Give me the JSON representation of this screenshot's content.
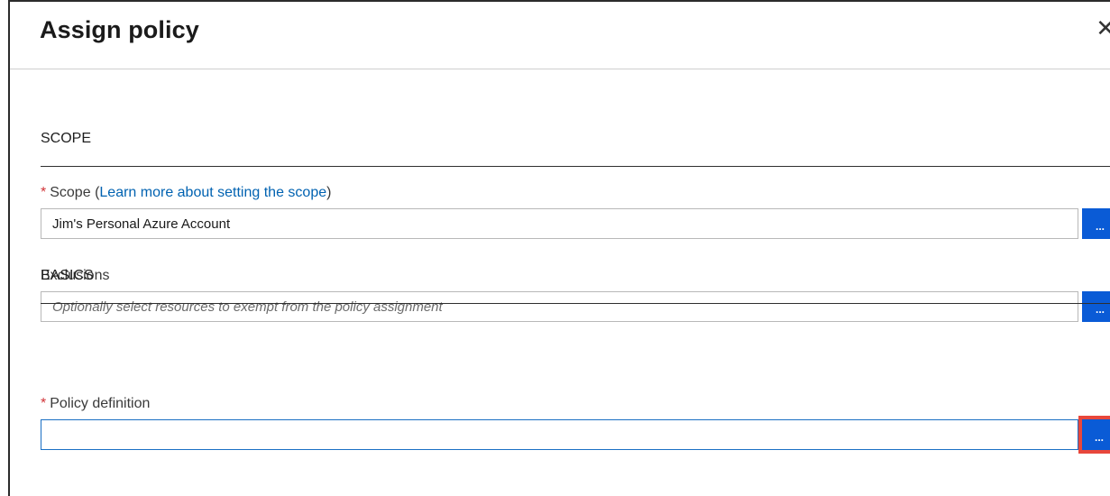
{
  "panel": {
    "title": "Assign policy",
    "close_glyph": "✕"
  },
  "scope_section": {
    "title": "SCOPE",
    "scope_field": {
      "required_mark": "*",
      "label": "Scope",
      "link_open": "(",
      "link_text": "Learn more about setting the scope",
      "link_close": ")",
      "value": "Jim's Personal Azure Account",
      "browse_label": "..."
    },
    "exclusions_field": {
      "label": "Exclusions",
      "placeholder": "Optionally select resources to exempt from the policy assignment",
      "value": "",
      "browse_label": "..."
    }
  },
  "basics_section": {
    "title": "BASICS",
    "policy_definition_field": {
      "required_mark": "*",
      "label": "Policy definition",
      "value": "",
      "browse_label": "..."
    }
  },
  "colors": {
    "accent": "#0a5bd6",
    "link": "#0062b1",
    "required": "#d13438",
    "highlight": "#e8473b"
  }
}
